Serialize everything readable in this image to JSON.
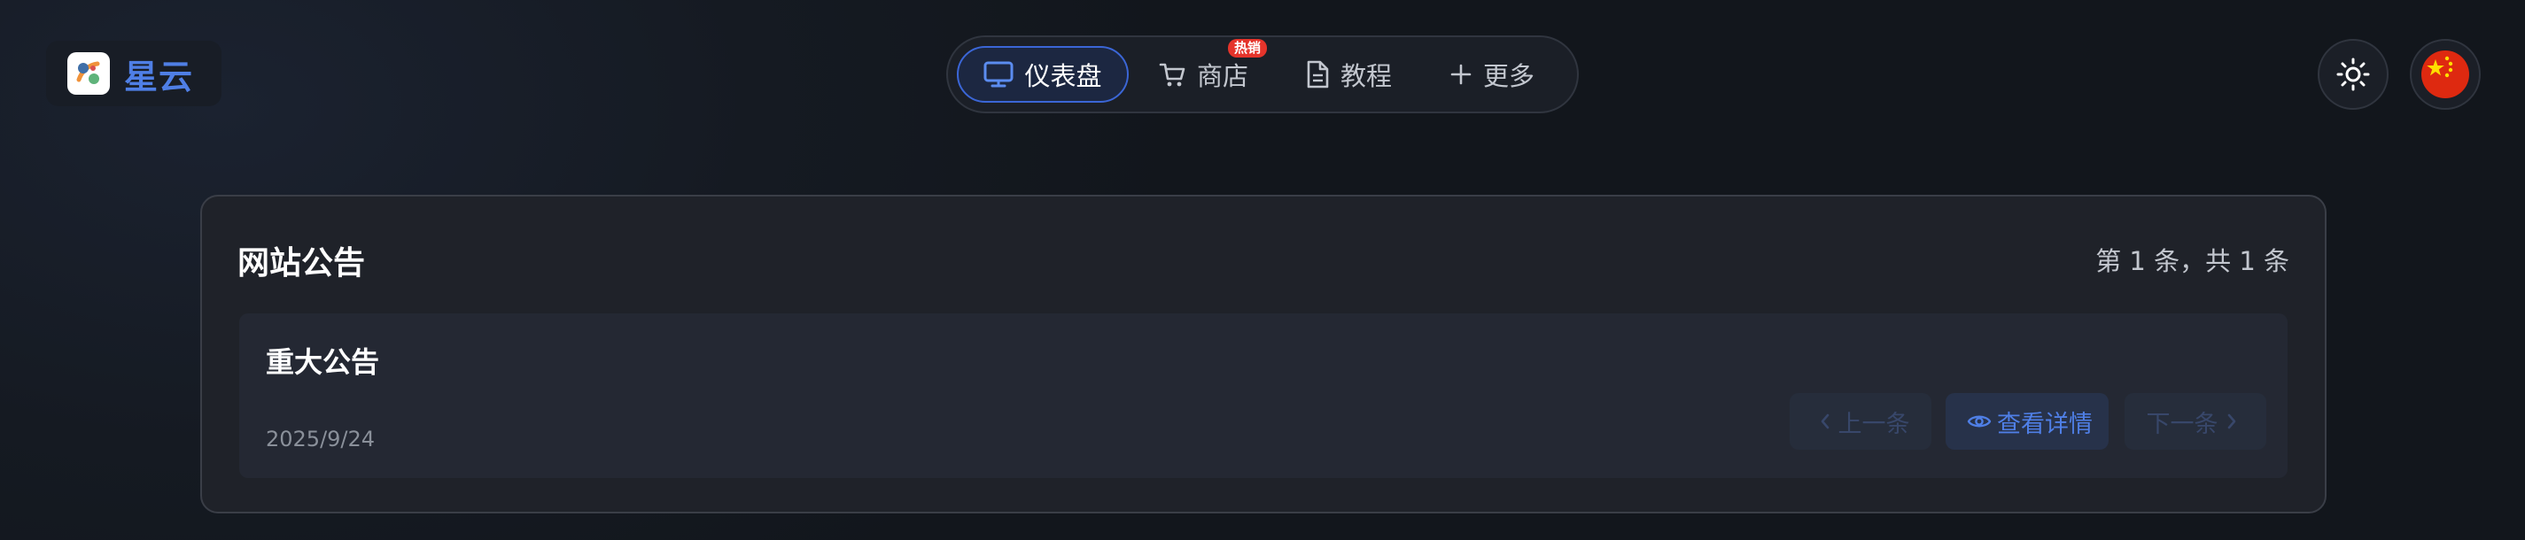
{
  "brand": {
    "name": "星云"
  },
  "nav": {
    "items": [
      {
        "label": "仪表盘",
        "icon": "monitor-icon",
        "active": true
      },
      {
        "label": "商店",
        "icon": "cart-icon",
        "badge": "热销"
      },
      {
        "label": "教程",
        "icon": "document-icon"
      },
      {
        "label": "更多",
        "icon": "plus-icon"
      }
    ]
  },
  "header_actions": {
    "theme_icon": "sun-icon",
    "language_icon": "china-flag-icon"
  },
  "announcement": {
    "title": "网站公告",
    "count": "第 1 条，共 1 条",
    "item": {
      "title": "重大公告",
      "date": "2025/9/24"
    },
    "prev_label": "上一条",
    "detail_label": "查看详情",
    "next_label": "下一条"
  },
  "colors": {
    "accent": "#4f7fe6",
    "badge": "#e5342b",
    "background": "#151a22",
    "card": "#1f2229"
  }
}
